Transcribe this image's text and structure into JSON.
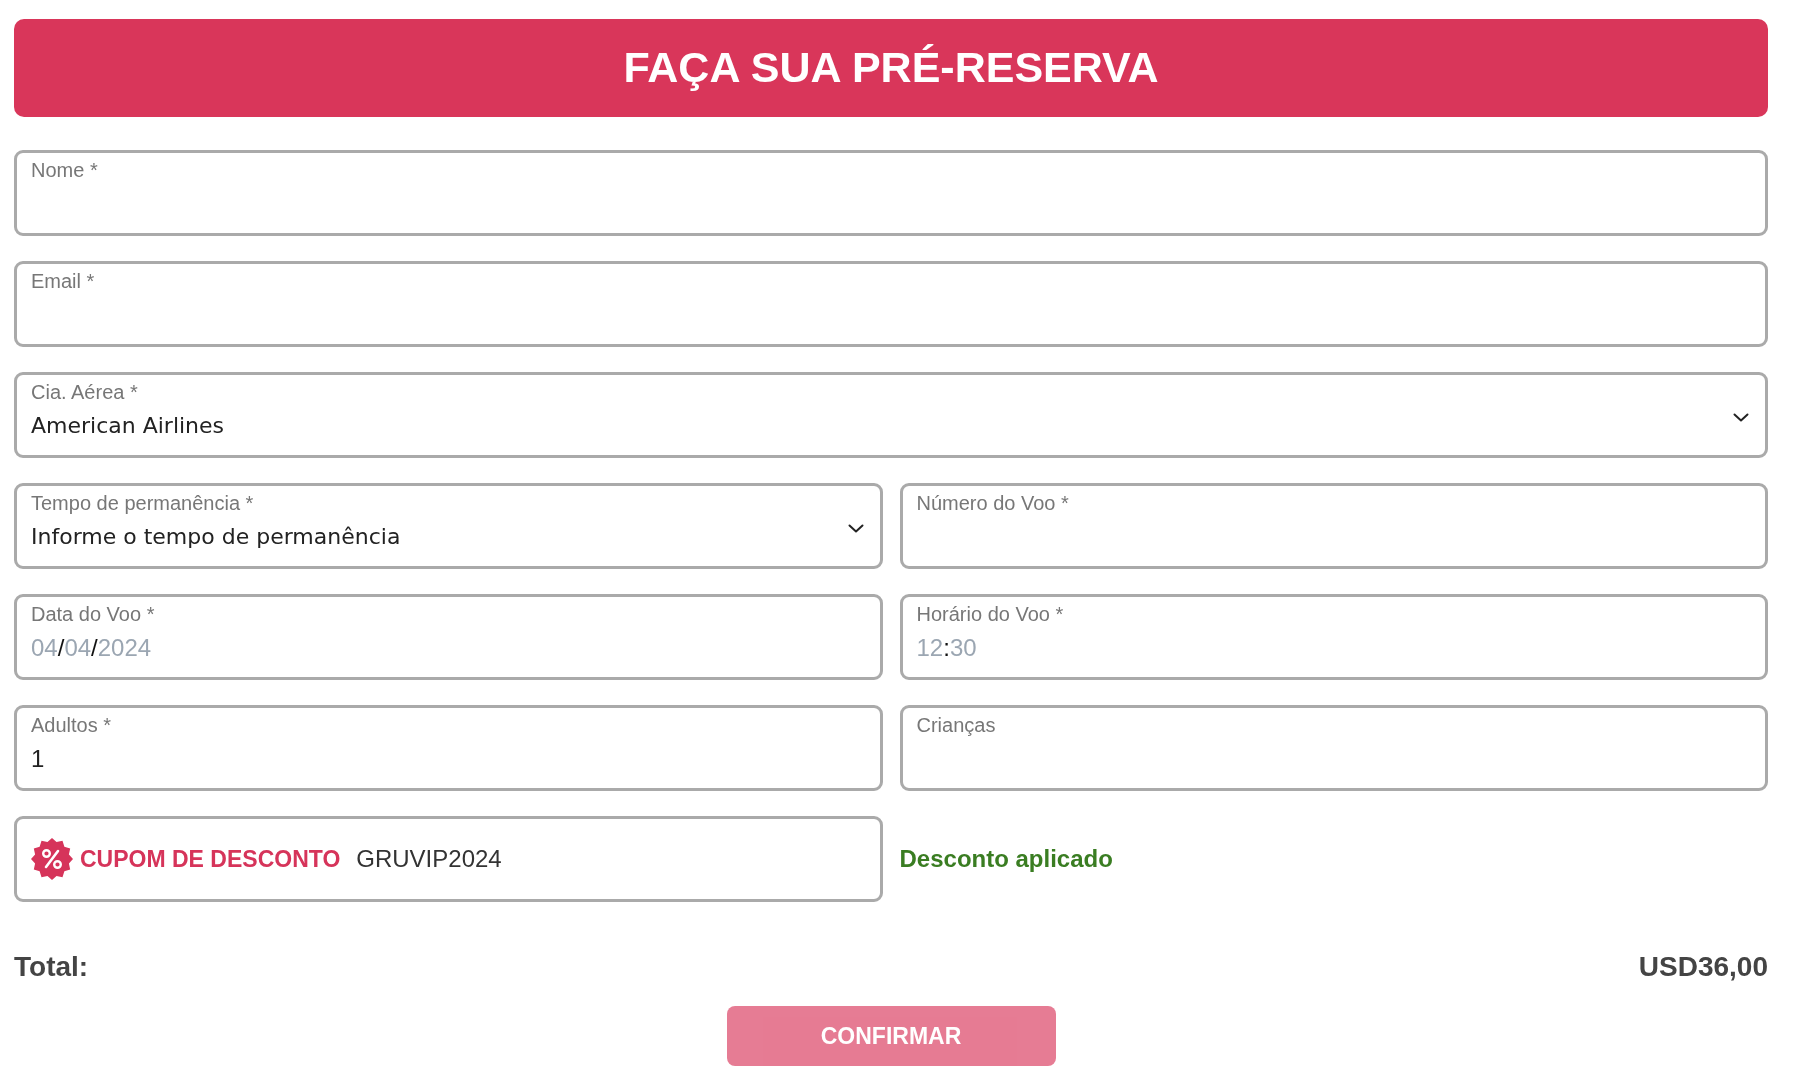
{
  "header": {
    "title": "FAÇA SUA PRÉ-RESERVA"
  },
  "form": {
    "rows": [
      {
        "fields": [
          {
            "kind": "text",
            "label": "Nome *"
          }
        ]
      },
      {
        "fields": [
          {
            "kind": "text",
            "label": "Email *"
          }
        ]
      },
      {
        "fields": [
          {
            "kind": "select",
            "label": "Cia. Aérea *",
            "value": "American Airlines"
          }
        ]
      },
      {
        "fields": [
          {
            "kind": "select",
            "label": "Tempo de permanência *",
            "value": "Informe o tempo de permanência"
          },
          {
            "kind": "text",
            "label": "Número do Voo *"
          }
        ]
      },
      {
        "fields": [
          {
            "kind": "date",
            "label": "Data do Voo *",
            "placeholder": "04/04/2024"
          },
          {
            "kind": "time",
            "label": "Horário do Voo *",
            "placeholder": "12:30"
          }
        ]
      },
      {
        "fields": [
          {
            "kind": "text",
            "label": "Adultos *",
            "value": "1"
          },
          {
            "kind": "text",
            "label": "Crianças"
          }
        ]
      },
      {
        "fields": [
          {
            "kind": "coupon",
            "label": "CUPOM DE DESCONTO",
            "value": "GRUVIP2024"
          },
          {
            "kind": "status",
            "text": "Desconto aplicado"
          }
        ]
      }
    ]
  },
  "total": {
    "label": "Total:",
    "amount": "USD36,00"
  },
  "confirm_button": {
    "label": "CONFIRMAR",
    "disabled": true
  }
}
